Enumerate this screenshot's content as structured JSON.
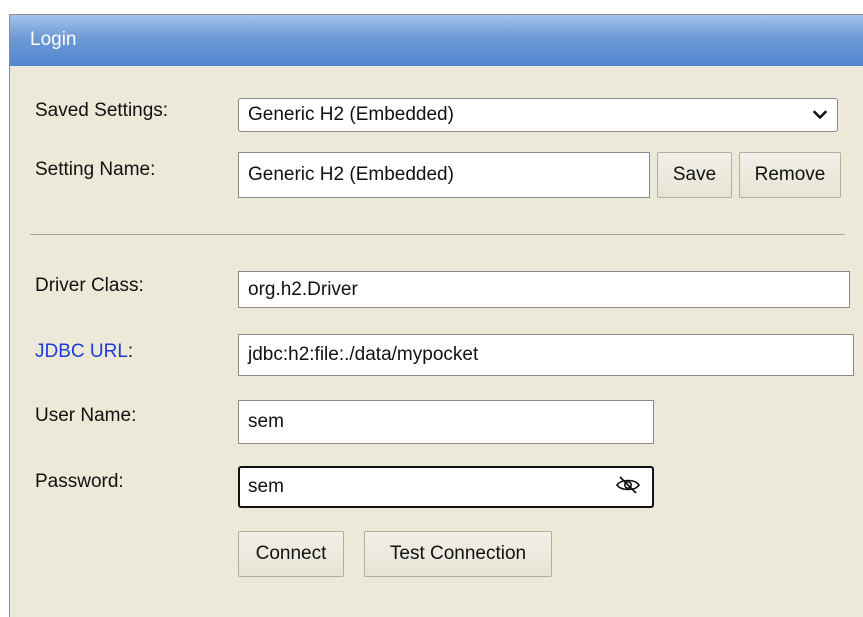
{
  "window": {
    "title": "Login"
  },
  "form": {
    "saved_settings": {
      "label": "Saved Settings:",
      "value": "Generic H2 (Embedded)"
    },
    "setting_name": {
      "label": "Setting Name:",
      "value": "Generic H2 (Embedded)",
      "save_label": "Save",
      "remove_label": "Remove"
    },
    "driver_class": {
      "label": "Driver Class:",
      "value": "org.h2.Driver"
    },
    "jdbc_url": {
      "link_text": "JDBC URL",
      "suffix": ":",
      "value": "jdbc:h2:file:./data/mypocket"
    },
    "user_name": {
      "label": "User Name:",
      "value": "sem"
    },
    "password": {
      "label": "Password:",
      "value": "sem",
      "toggle_icon": "eye-slash-icon"
    },
    "actions": {
      "connect_label": "Connect",
      "test_label": "Test Connection"
    }
  },
  "colors": {
    "panel_bg": "#ece9d8",
    "title_bar": "#6f9ad6",
    "link": "#1f3cd8"
  }
}
